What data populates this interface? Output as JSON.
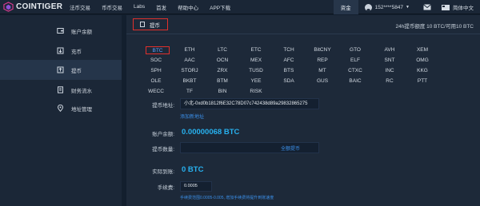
{
  "header": {
    "logo_text": "COINTIGER",
    "nav": [
      "法币交易",
      "币币交易",
      "Labs",
      "首发",
      "帮助中心",
      "APP下载"
    ],
    "asset_tab": "资金",
    "user": "152****5847",
    "language": "简体中文"
  },
  "sidebar": {
    "items": [
      {
        "label": "账户余额",
        "icon": "wallet-icon"
      },
      {
        "label": "充币",
        "icon": "deposit-icon"
      },
      {
        "label": "提币",
        "icon": "withdraw-icon"
      },
      {
        "label": "财务流水",
        "icon": "ledger-icon"
      },
      {
        "label": "地址管理",
        "icon": "location-icon"
      }
    ],
    "active": "提币"
  },
  "main": {
    "tab_label": "提币",
    "limit_text": "24h提币额度 10 BTC/可用10 BTC",
    "coin_rows": [
      [
        "BTC",
        "ETH",
        "LTC",
        "ETC",
        "TCH",
        "BitCNY",
        "GTO",
        "AVH",
        "XEM"
      ],
      [
        "SOC",
        "AAC",
        "OCN",
        "MEX",
        "AFC",
        "REP",
        "ELF",
        "SNT",
        "OMG"
      ],
      [
        "SPH",
        "STORJ",
        "ZRX",
        "TUSD",
        "BTS",
        "MT",
        "CTXC",
        "INC",
        "KKG"
      ],
      [
        "OLE",
        "BKBT",
        "BTM",
        "YEE",
        "SDA",
        "GUS",
        "BAIC",
        "RC",
        "PTT"
      ],
      [
        "WECC",
        "TF",
        "BIN",
        "RISK"
      ]
    ],
    "selected_coin": "BTC",
    "address_label": "提币地址:",
    "address_value": "小北-0xd0b1812f6E32C78D07c742438d89a29832865275",
    "add_address_link": "添加新地址",
    "balance_label": "账户余额:",
    "balance_value": "0.00000068 BTC",
    "amount_label": "提币数量:",
    "amount_value": "",
    "all_button": "全额提币",
    "arrive_label": "实际到账:",
    "arrive_value": "0 BTC",
    "fee_label": "手续费:",
    "fee_value": "0.0005",
    "fee_note": "手续费范围0.0005-0.005, 增加手续费将提升到账速度"
  },
  "colors": {
    "accent_red": "#e0302c",
    "link_blue": "#3b8fe8",
    "value_cyan": "#27b1ef",
    "background": "#131f2e"
  }
}
